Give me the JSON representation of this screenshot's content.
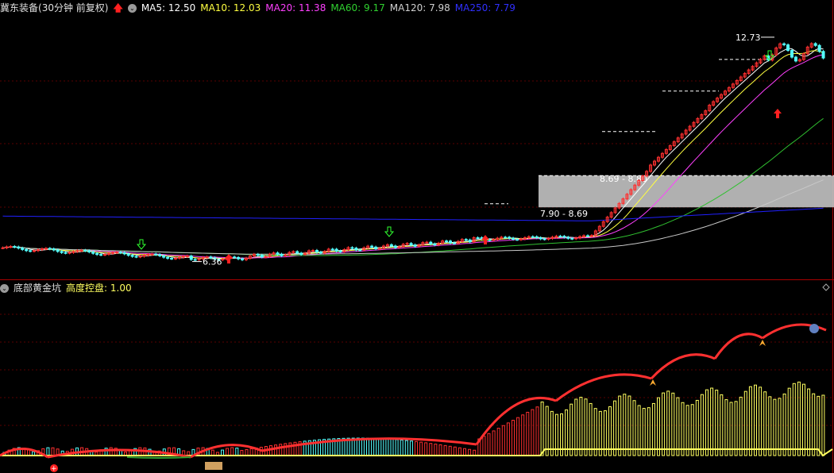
{
  "colors": {
    "up": "#ff3030",
    "down": "#54ffff",
    "ma5": "#ffffff",
    "ma10": "#ffff40",
    "ma20": "#ff40ff",
    "ma60": "#30c030",
    "ma120": "#c8c8c8",
    "ma250": "#2020ff",
    "grid": "#5a0000",
    "border": "#aa0000",
    "zone": "#bfbfbf",
    "yellowBar": "#ffff60",
    "cyanBar": "#54ffff"
  },
  "header": {
    "stock_name": "冀东装备",
    "period": "(30分钟 前复权)",
    "ma5_label": "MA5: 12.50",
    "ma10_label": "MA10: 12.03",
    "ma20_label": "MA20: 11.38",
    "ma60_label": "MA60: 9.17",
    "ma120_label": "MA120: 7.98",
    "ma250_label": "MA250: 7.79"
  },
  "indicator": {
    "name": "底部黄金坑",
    "param_label": "高度控盘: 1.00"
  },
  "chart_data": [
    {
      "type": "candlestick",
      "y_range": [
        5.9,
        13.2
      ],
      "annotations": {
        "high_label": "12.73",
        "low_label": "6.36",
        "zone_upper_label": "8.69 - 8.80",
        "zone_lower_label": "7.90 - 8.69",
        "zone_range": [
          7.9,
          8.8
        ]
      }
    },
    {
      "type": "bar",
      "name": "底部黄金坑",
      "value_label": "1.00"
    }
  ]
}
